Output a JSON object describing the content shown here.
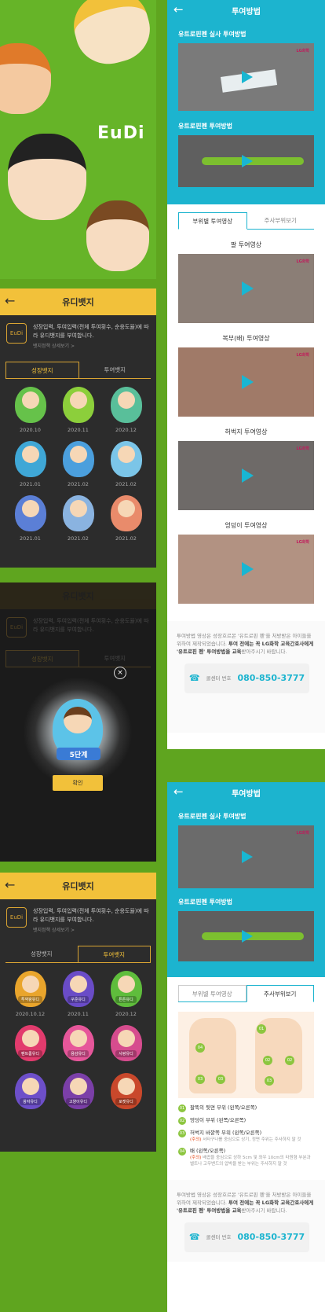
{
  "colors": {
    "green_bg": "#5fa51f",
    "yellow": "#f2c13a",
    "cyan": "#1cb4cf",
    "dark": "#2c2c2c"
  },
  "hero": {
    "logo": "EuDi"
  },
  "badge_screen": {
    "title": "유디뱃지",
    "info_text": "성장입력, 투여입력(전체 투여횟수, 순응도율)에 따라 유디뱃지를 부여합니다.",
    "info_link": "뱃지정책 상세보기 >",
    "crest_label": "EuDi",
    "tabs": [
      "성장뱃지",
      "투여뱃지"
    ],
    "growth_badges": [
      {
        "date": "2020.10",
        "color": "#66c24a"
      },
      {
        "date": "2020.11",
        "color": "#8ccf3b"
      },
      {
        "date": "2020.12",
        "color": "#59bf9a"
      },
      {
        "date": "2021.01",
        "color": "#3fa7d6"
      },
      {
        "date": "2021.02",
        "color": "#4b9fdd"
      },
      {
        "date": "2021.02",
        "color": "#7bc5e8"
      },
      {
        "date": "2021.01",
        "color": "#5b7fd6"
      },
      {
        "date": "2021.02",
        "color": "#8ab3e0"
      },
      {
        "date": "2021.02",
        "color": "#e98b6b"
      }
    ],
    "dose_badges": [
      {
        "date": "2020.10.12",
        "label": "투약왕유디",
        "color": "#e9a52c"
      },
      {
        "date": "2020.11",
        "label": "꾸준유디",
        "color": "#6a4cc7"
      },
      {
        "date": "2020.12",
        "label": "튼튼유디",
        "color": "#5fbd3c"
      },
      {
        "date": "",
        "label": "팬트롬유디",
        "color": "#e23b6d"
      },
      {
        "date": "",
        "label": "용감유디",
        "color": "#e6569a"
      },
      {
        "date": "",
        "label": "사랑유디",
        "color": "#d64c8e"
      },
      {
        "date": "",
        "label": "왕자유디",
        "color": "#6d4fc9"
      },
      {
        "date": "",
        "label": "고양이유디",
        "color": "#7b3fa8"
      },
      {
        "date": "",
        "label": "로켓유디",
        "color": "#c9482b"
      }
    ]
  },
  "modal": {
    "stage": "5단계",
    "confirm": "확인",
    "close": "×"
  },
  "dosage": {
    "title": "투여방법",
    "video1_title": "유트로핀펜 실사 투여방법",
    "video2_title": "유트로핀펜 투여방법",
    "lg_mark": "LG화학",
    "tabs": [
      "부위별 투여영상",
      "주사부위보기"
    ],
    "parts": [
      "팔 투여영상",
      "복부(배) 투여영상",
      "허벅지 투여영상",
      "엉덩이 투여영상"
    ],
    "notice_1": "투여방법 영상은 성장호르몬 '유트로핀 펜'을 처방받은 아이들을 위하여 제작되었습니다.",
    "notice_2": "투여 전에는 꼭 LG화학 교육간호사에게 '유트로핀 펜' 투여방법을 교육",
    "notice_3": "받아주시기 바랍니다.",
    "call_label": "콜센터 번호",
    "call_number": "080-850-3777",
    "sites": [
      {
        "no": "01",
        "label": "팔뚝의 뒷면 부위 (왼쪽/오른쪽)",
        "sub": ""
      },
      {
        "no": "02",
        "label": "엉덩이 부위 (왼쪽/오른쪽)",
        "sub": ""
      },
      {
        "no": "03",
        "label": "허벅지 바깥쪽 부위 (왼쪽/오른쪽)",
        "sub_em": "(주의)",
        "sub": " 서타구나를 중심으로 상기, 정면 주위는 주사하지 말 것"
      },
      {
        "no": "04",
        "label": "배 (왼쪽/오른쪽)",
        "sub_em": "(주의)",
        "sub": " 배꼽을 중심으로 상하 5cm 및 좌우 10cm의 타원형 부분과 벨트나 고무밴드의 압박을 받는 부위는 주사하지 말 것"
      }
    ]
  }
}
